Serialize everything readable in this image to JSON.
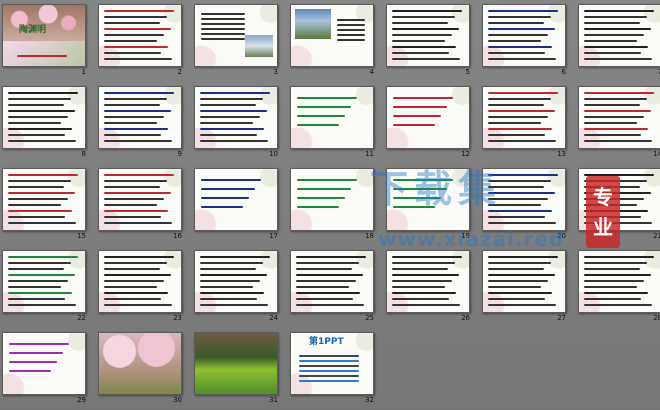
{
  "slides": [
    {
      "n": "1",
      "kind": "title",
      "title": "陶渊明"
    },
    {
      "n": "2",
      "kind": "text",
      "color": "#c0282d"
    },
    {
      "n": "3",
      "kind": "text-photo"
    },
    {
      "n": "4",
      "kind": "photo-text"
    },
    {
      "n": "5",
      "kind": "text",
      "color": "#222"
    },
    {
      "n": "6",
      "kind": "text",
      "color": "#1a2f8a"
    },
    {
      "n": "7",
      "kind": "text",
      "color": "#222"
    },
    {
      "n": "8",
      "kind": "text",
      "color": "#222"
    },
    {
      "n": "9",
      "kind": "text",
      "color": "#1a2f8a"
    },
    {
      "n": "10",
      "kind": "text",
      "color": "#1a2f8a"
    },
    {
      "n": "11",
      "kind": "sparse",
      "color": "#1a8a3a"
    },
    {
      "n": "12",
      "kind": "sparse",
      "color": "#c0282d"
    },
    {
      "n": "13",
      "kind": "text",
      "color": "#c0282d"
    },
    {
      "n": "14",
      "kind": "text",
      "color": "#c0282d"
    },
    {
      "n": "15",
      "kind": "text",
      "color": "#c0282d"
    },
    {
      "n": "16",
      "kind": "text",
      "color": "#c0282d"
    },
    {
      "n": "17",
      "kind": "sparse",
      "color": "#1a2f8a"
    },
    {
      "n": "18",
      "kind": "sparse",
      "color": "#1a8a3a"
    },
    {
      "n": "19",
      "kind": "sparse",
      "color": "#1a8a3a"
    },
    {
      "n": "20",
      "kind": "text",
      "color": "#1a2f8a"
    },
    {
      "n": "21",
      "kind": "text",
      "color": "#222"
    },
    {
      "n": "22",
      "kind": "text",
      "color": "#1a8a3a"
    },
    {
      "n": "23",
      "kind": "text",
      "color": "#222"
    },
    {
      "n": "24",
      "kind": "text",
      "color": "#222"
    },
    {
      "n": "25",
      "kind": "text",
      "color": "#222"
    },
    {
      "n": "26",
      "kind": "text",
      "color": "#222"
    },
    {
      "n": "27",
      "kind": "text",
      "color": "#222"
    },
    {
      "n": "28",
      "kind": "text",
      "color": "#222"
    },
    {
      "n": "29",
      "kind": "sparse",
      "color": "#9a2fb0"
    },
    {
      "n": "30",
      "kind": "photo-blossom"
    },
    {
      "n": "31",
      "kind": "photo-field"
    },
    {
      "n": "32",
      "kind": "end",
      "title": "第1PPT"
    }
  ],
  "watermark": {
    "main": "下载集",
    "url": "www.xiazai.red",
    "seal": "专业"
  }
}
